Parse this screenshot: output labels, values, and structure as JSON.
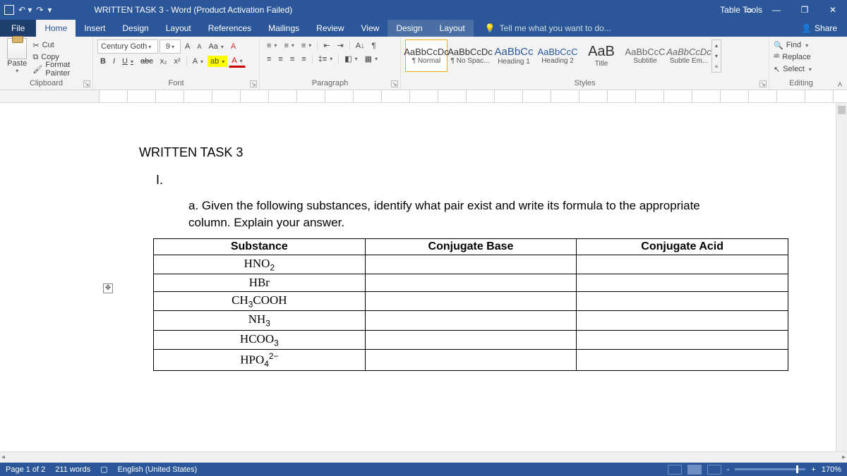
{
  "titlebar": {
    "app_title": "WRITTEN TASK 3 - Word (Product Activation Failed)",
    "context_tools": "Table Tools"
  },
  "tabs": {
    "file": "File",
    "home": "Home",
    "insert": "Insert",
    "design": "Design",
    "layout": "Layout",
    "references": "References",
    "mailings": "Mailings",
    "review": "Review",
    "view": "View",
    "t_design": "Design",
    "t_layout": "Layout",
    "tell_me": "Tell me what you want to do...",
    "share": "Share"
  },
  "ribbon": {
    "clipboard": {
      "label": "Clipboard",
      "paste": "Paste",
      "cut": "Cut",
      "copy": "Copy",
      "format_painter": "Format Painter"
    },
    "font": {
      "label": "Font",
      "family": "Century Goth",
      "size": "9",
      "grow": "A",
      "shrink": "A",
      "case": "Aa",
      "clear": "A",
      "bold": "B",
      "italic": "I",
      "underline": "U",
      "strike": "abc",
      "sub": "x₂",
      "sup": "x²",
      "effects": "A",
      "hl": "ab",
      "color": "A"
    },
    "paragraph": {
      "label": "Paragraph"
    },
    "styles": {
      "label": "Styles",
      "items": [
        {
          "prev": "AaBbCcDc",
          "name": "¶ Normal"
        },
        {
          "prev": "AaBbCcDc",
          "name": "¶ No Spac..."
        },
        {
          "prev": "AaBbCc",
          "name": "Heading 1"
        },
        {
          "prev": "AaBbCcC",
          "name": "Heading 2"
        },
        {
          "prev": "AaB",
          "name": "Title"
        },
        {
          "prev": "AaBbCcC",
          "name": "Subtitle"
        },
        {
          "prev": "AaBbCcDc",
          "name": "Subtle Em..."
        }
      ]
    },
    "editing": {
      "label": "Editing",
      "find": "Find",
      "replace": "Replace",
      "select": "Select"
    }
  },
  "doc": {
    "heading": "WRITTEN TASK 3",
    "num": "I.",
    "prompt": "a. Given the following substances, identify what pair exist and write its formula to the appropriate column. Explain your answer.",
    "cols": {
      "c1": "Substance",
      "c2": "Conjugate Base",
      "c3": "Conjugate Acid"
    },
    "rows": [
      "HNO2",
      "HBr",
      "CH3COOH",
      "NH3",
      "HCOO3",
      "HPO4_2-"
    ]
  },
  "status": {
    "page": "Page 1 of 2",
    "words": "211 words",
    "lang": "English (United States)",
    "zoom": "170%",
    "minus": "-",
    "plus": "+"
  }
}
